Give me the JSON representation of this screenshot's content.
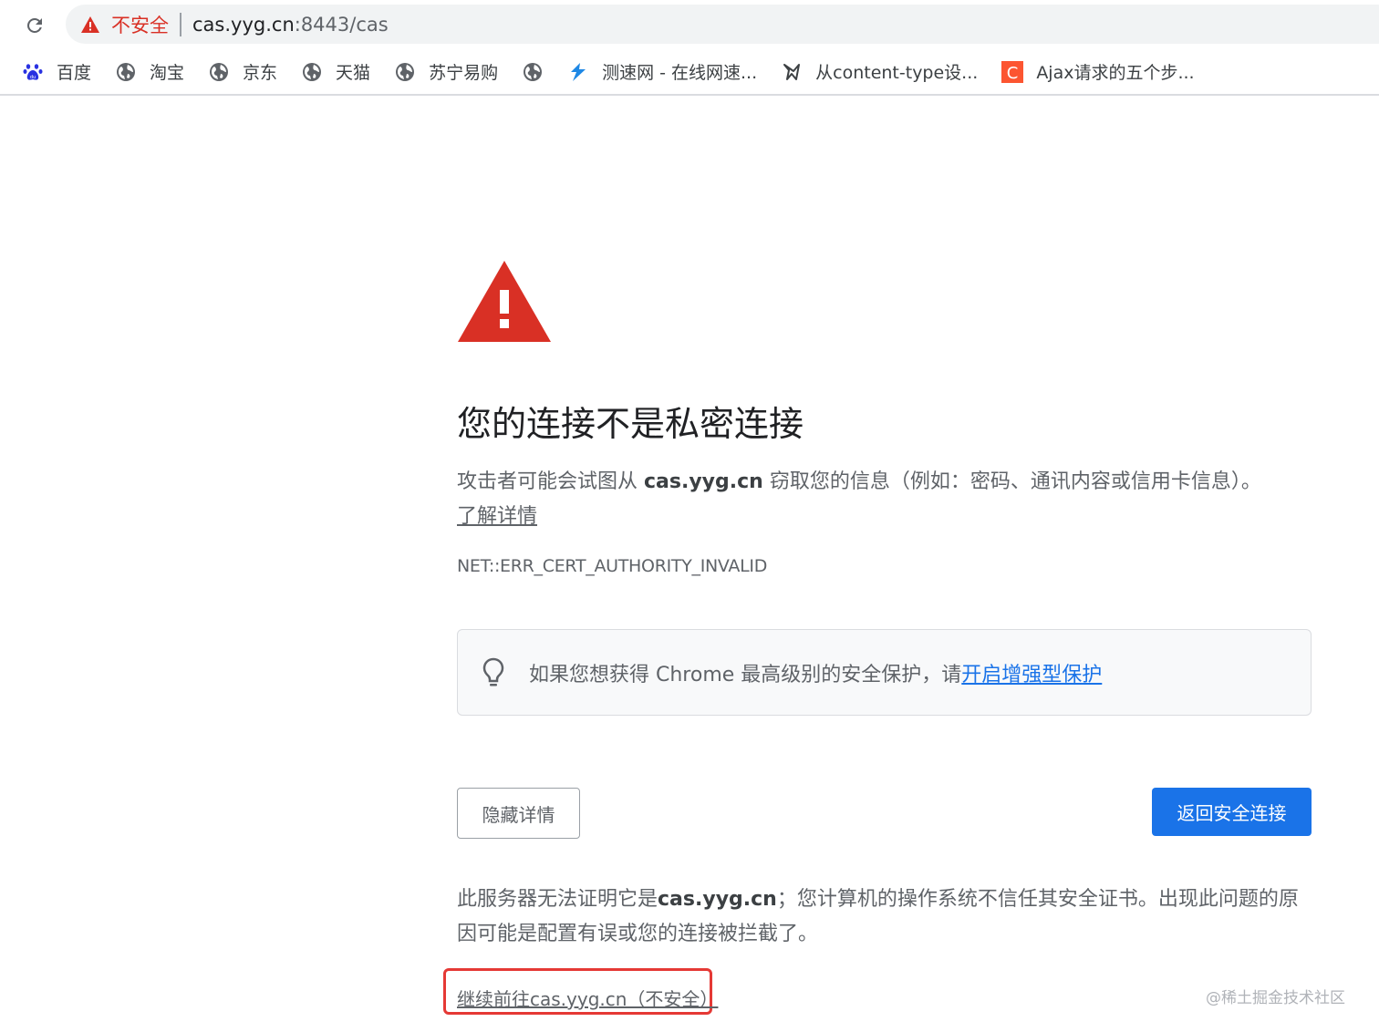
{
  "browser": {
    "security_label": "不安全",
    "url_host": "cas.yyg.cn",
    "url_rest": ":8443/cas"
  },
  "bookmarks": [
    {
      "label": "百度",
      "icon": "baidu-paw-icon"
    },
    {
      "label": "淘宝",
      "icon": "globe-icon"
    },
    {
      "label": "京东",
      "icon": "globe-icon"
    },
    {
      "label": "天猫",
      "icon": "globe-icon"
    },
    {
      "label": "苏宁易购",
      "icon": "globe-icon"
    },
    {
      "label": "",
      "icon": "globe-icon"
    },
    {
      "label": "测速网 - 在线网速...",
      "icon": "speedtest-icon"
    },
    {
      "label": "从content-type设...",
      "icon": "wolf-icon"
    },
    {
      "label": "Ajax请求的五个步...",
      "icon": "csdn-c-icon"
    }
  ],
  "page": {
    "heading": "您的连接不是私密连接",
    "desc_prefix": "攻击者可能会试图从 ",
    "desc_host": "cas.yyg.cn",
    "desc_suffix": " 窃取您的信息（例如：密码、通讯内容或信用卡信息）。",
    "learn_more": "了解详情",
    "error_code": "NET::ERR_CERT_AUTHORITY_INVALID",
    "tip_text": "如果您想获得 Chrome 最高级别的安全保护，请",
    "tip_link": "开启增强型保护",
    "hide_details_button": "隐藏详情",
    "back_button": "返回安全连接",
    "details_prefix": "此服务器无法证明它是",
    "details_host": "cas.yyg.cn",
    "details_suffix": "；您计算机的操作系统不信任其安全证书。出现此问题的原因可能是配置有误或您的连接被拦截了。",
    "proceed_link": "继续前往cas.yyg.cn（不安全）",
    "watermark": "@稀土掘金技术社区"
  },
  "colors": {
    "danger": "#d93025",
    "link": "#1a73e8",
    "primary_button": "#1a73e8",
    "highlight_frame": "#e53935"
  }
}
